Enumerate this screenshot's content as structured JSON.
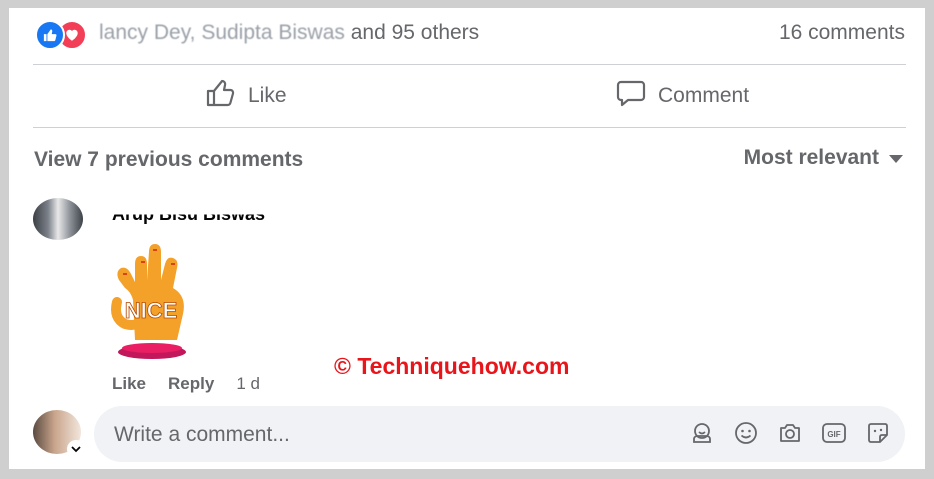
{
  "post": {
    "reactions": {
      "names_text": "lancy Dey, Sudipta Biswas",
      "others_text": "and 95 others",
      "icons": [
        "like-icon",
        "love-icon"
      ]
    },
    "comments_count_label": "16 comments",
    "actions": {
      "like_label": "Like",
      "comment_label": "Comment"
    }
  },
  "comments_section": {
    "view_previous_label": "View 7 previous comments",
    "sort_label": "Most relevant",
    "items": [
      {
        "author": "Arup Bisu Biswas",
        "sticker_text": "NICE",
        "like_label": "Like",
        "reply_label": "Reply",
        "time": "1 d"
      }
    ]
  },
  "watermark": "© Techniquehow.com",
  "composer": {
    "placeholder": "Write a comment...",
    "tools": [
      "avatar-sticker-icon",
      "emoji-icon",
      "camera-icon",
      "gif-icon",
      "sticker-icon"
    ]
  },
  "colors": {
    "accent": "#1877f2",
    "love": "#f33e58",
    "muted_text": "#65676b",
    "watermark": "#e8151b",
    "input_bg": "#f0f2f5"
  }
}
